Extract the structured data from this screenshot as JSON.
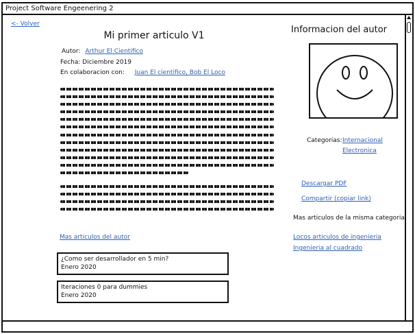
{
  "window": {
    "title": "Project Software Engeenering 2"
  },
  "nav": {
    "back_label": "<- Volver"
  },
  "article": {
    "title": "Mi primer articulo V1",
    "author_label": "Autor:",
    "author_value": "Arthur El Cientifico",
    "date_label": "Fecha:",
    "date_value": "Diciembre 2019",
    "collab_label": "En colaboracion con:",
    "collab_value": "Juan El cientifico, Bob El Loco"
  },
  "more_by_author": {
    "label": "Mas articulos del autor",
    "items": [
      {
        "title": "¿Como ser desarrollador en 5 min?",
        "date": "Enero 2020"
      },
      {
        "title": "Iteraciones 0 para dummies",
        "date": "Enero 2020"
      }
    ]
  },
  "author_panel": {
    "heading": "Informacion del autor",
    "photo_icon": "smiley-face-icon",
    "categories_label": "Categorias:",
    "categories": [
      "Internacional",
      "Electronica"
    ]
  },
  "actions": {
    "download": "Descargar PDF",
    "share": "Compartir (copiar link)"
  },
  "related": {
    "heading": "Mas articulos de la misma categoria",
    "items": [
      "Locos articulos de ingenieria",
      "Ingenieria al cuadrado"
    ]
  },
  "colors": {
    "link": "#2d5fb4",
    "border": "#111111",
    "background": "#ffffff"
  }
}
